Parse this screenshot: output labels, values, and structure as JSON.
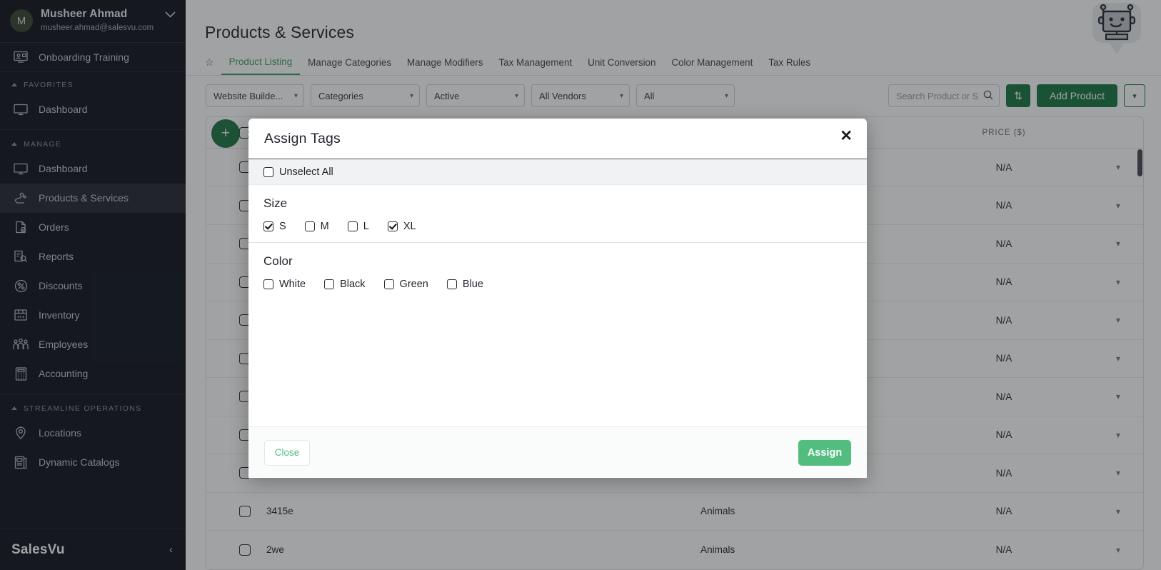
{
  "sidebar": {
    "user": {
      "initial": "M",
      "name": "Musheer Ahmad",
      "email": "musheer.ahmad@salesvu.com"
    },
    "onboarding": {
      "label": "Onboarding Training"
    },
    "groups": [
      {
        "label": "FAVORITES",
        "items": [
          {
            "label": "Dashboard",
            "icon": "monitor-icon",
            "active": false
          }
        ]
      },
      {
        "label": "MANAGE",
        "items": [
          {
            "label": "Dashboard",
            "icon": "monitor-icon",
            "active": false
          },
          {
            "label": "Products & Services",
            "icon": "products-icon",
            "active": true
          },
          {
            "label": "Orders",
            "icon": "orders-icon",
            "active": false
          },
          {
            "label": "Reports",
            "icon": "reports-icon",
            "active": false
          },
          {
            "label": "Discounts",
            "icon": "percent-icon",
            "active": false
          },
          {
            "label": "Inventory",
            "icon": "inventory-icon",
            "active": false
          },
          {
            "label": "Employees",
            "icon": "employees-icon",
            "active": false
          },
          {
            "label": "Accounting",
            "icon": "calculator-icon",
            "active": false
          }
        ]
      },
      {
        "label": "STREAMLINE OPERATIONS",
        "items": [
          {
            "label": "Locations",
            "icon": "location-pin-icon",
            "active": false
          },
          {
            "label": "Dynamic Catalogs",
            "icon": "catalog-icon",
            "active": false
          }
        ]
      }
    ],
    "brand": "SalesVu",
    "collapse_glyph": "‹"
  },
  "header": {
    "title": "Products & Services"
  },
  "tabs": [
    {
      "label": "Product Listing",
      "active": true
    },
    {
      "label": "Manage Categories",
      "active": false
    },
    {
      "label": "Manage Modifiers",
      "active": false
    },
    {
      "label": "Tax Management",
      "active": false
    },
    {
      "label": "Unit Conversion",
      "active": false
    },
    {
      "label": "Color Management",
      "active": false
    },
    {
      "label": "Tax Rules",
      "active": false
    }
  ],
  "toolbar": {
    "filters": [
      {
        "value": "Website Builde...",
        "name": "website-builder-filter"
      },
      {
        "value": "Categories",
        "name": "categories-filter"
      },
      {
        "value": "Active",
        "name": "status-filter"
      },
      {
        "value": "All Vendors",
        "name": "vendor-filter"
      },
      {
        "value": "All",
        "name": "all-filter"
      }
    ],
    "search_placeholder": "Search Product or S",
    "sort_glyph": "⇅",
    "add_product_label": "Add Product",
    "add_caret_glyph": "⌄"
  },
  "table": {
    "columns": [
      "",
      "",
      "",
      "PRICE ($)",
      ""
    ],
    "price_header": "PRICE ($)",
    "rows": [
      {
        "name": "",
        "category": "",
        "price": "N/A"
      },
      {
        "name": "",
        "category": "",
        "price": "N/A"
      },
      {
        "name": "",
        "category": "",
        "price": "N/A"
      },
      {
        "name": "",
        "category": "",
        "price": "N/A"
      },
      {
        "name": "",
        "category": "",
        "price": "N/A"
      },
      {
        "name": "",
        "category": "",
        "price": "N/A"
      },
      {
        "name": "",
        "category": "",
        "price": "N/A"
      },
      {
        "name": "",
        "category": "",
        "price": "N/A"
      },
      {
        "name": "",
        "category": "",
        "price": "N/A"
      },
      {
        "name": "3415e",
        "category": "Animals",
        "price": "N/A"
      },
      {
        "name": "2we",
        "category": "Animals",
        "price": "N/A"
      }
    ],
    "row_caret_glyph": "⌄"
  },
  "modal": {
    "title": "Assign Tags",
    "close_glyph": "✕",
    "unselect_all": {
      "label": "Unselect All",
      "checked": false
    },
    "sections": [
      {
        "title": "Size",
        "options": [
          {
            "label": "S",
            "checked": true
          },
          {
            "label": "M",
            "checked": false
          },
          {
            "label": "L",
            "checked": false
          },
          {
            "label": "XL",
            "checked": true
          }
        ]
      },
      {
        "title": "Color",
        "options": [
          {
            "label": "White",
            "checked": false
          },
          {
            "label": "Black",
            "checked": false
          },
          {
            "label": "Green",
            "checked": false
          },
          {
            "label": "Blue",
            "checked": false
          }
        ]
      }
    ],
    "close_label": "Close",
    "assign_label": "Assign"
  },
  "colors": {
    "sidebar_bg": "#161b24",
    "accent_green": "#3aa363",
    "button_green": "#1f7a48",
    "assign_green": "#53bd7f",
    "link_green": "#49c27e"
  }
}
